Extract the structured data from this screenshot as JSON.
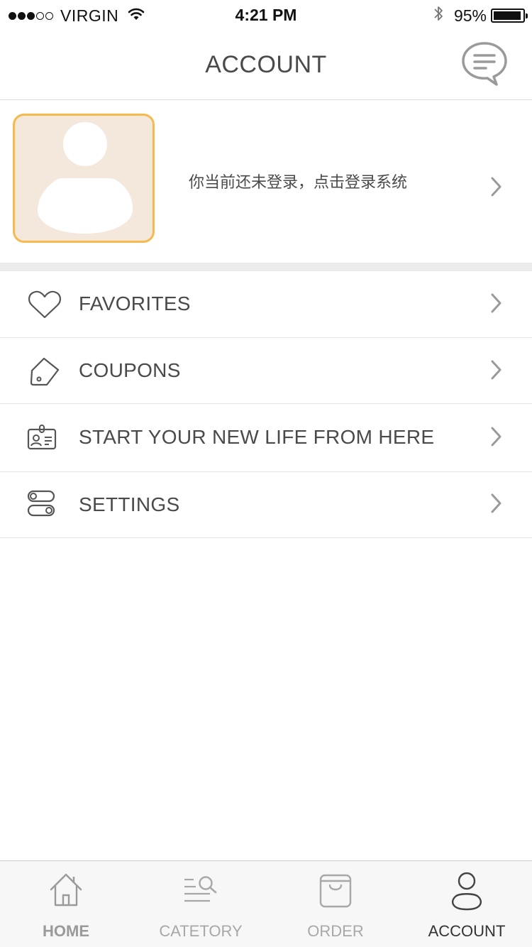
{
  "status_bar": {
    "signal_filled": 3,
    "signal_empty": 2,
    "carrier": "VIRGIN",
    "time": "4:21 PM",
    "battery": "95%",
    "battery_level": 0.95,
    "wifi_icon": "wifi-icon",
    "bluetooth_icon": "bluetooth-icon"
  },
  "nav": {
    "title": "ACCOUNT",
    "message_icon": "chat-bubble-icon"
  },
  "profile": {
    "login_prompt": "你当前还未登录，点击登录系统",
    "avatar_icon": "user-placeholder-icon",
    "avatar_bg": "#f4e8dd",
    "avatar_border": "#f5b94d"
  },
  "menu": {
    "items": [
      {
        "label": "FAVORITES",
        "icon": "heart-icon"
      },
      {
        "label": "COUPONS",
        "icon": "tag-icon"
      },
      {
        "label": "START YOUR NEW LIFE FROM HERE",
        "icon": "id-card-icon"
      },
      {
        "label": "SETTINGS",
        "icon": "toggles-icon"
      }
    ]
  },
  "tab_bar": {
    "tabs": [
      {
        "label": "HOME",
        "icon": "house-icon",
        "active": false
      },
      {
        "label": "CATETORY",
        "icon": "list-search-icon",
        "active": false
      },
      {
        "label": "ORDER",
        "icon": "shopping-bag-icon",
        "active": false
      },
      {
        "label": "ACCOUNT",
        "icon": "person-icon",
        "active": true
      }
    ]
  }
}
